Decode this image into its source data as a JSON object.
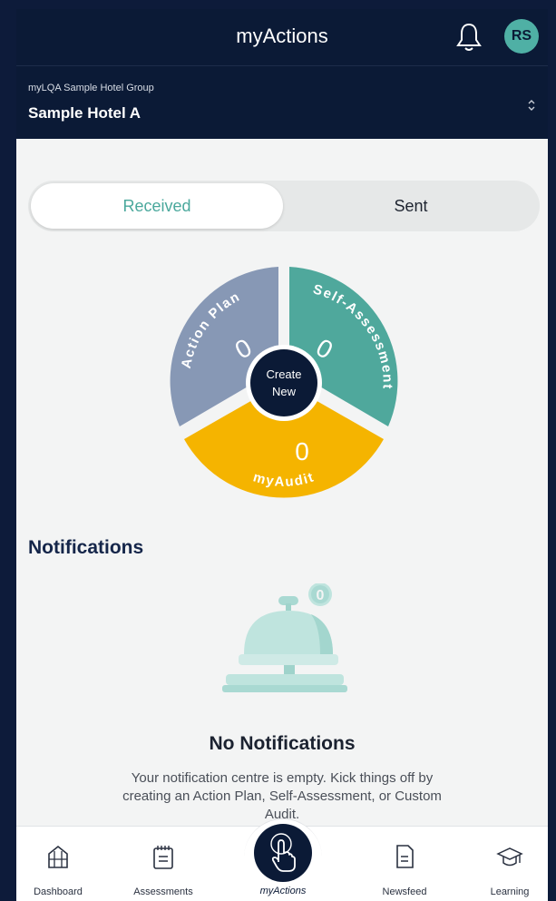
{
  "header": {
    "title": "myActions",
    "avatar_initials": "RS"
  },
  "hotel_bar": {
    "group": "myLQA Sample Hotel Group",
    "hotel": "Sample Hotel A"
  },
  "tabs": {
    "received": "Received",
    "sent": "Sent"
  },
  "dial": {
    "action_plan": {
      "label": "Action Plan",
      "count": "0",
      "color": "#8798b5"
    },
    "self_assessment": {
      "label": "Self-Assessment",
      "count": "0",
      "color": "#4fa89c"
    },
    "my_audit": {
      "label": "myAudit",
      "count": "0",
      "color": "#f5b400"
    },
    "center": {
      "line1": "Create",
      "line2": "New"
    }
  },
  "notifications": {
    "heading": "Notifications",
    "badge_count": "0",
    "empty_title": "No Notifications",
    "empty_text": "Your notification centre is empty. Kick things off by creating an Action Plan, Self-Assessment, or Custom Audit."
  },
  "bottom_nav": {
    "dashboard": "Dashboard",
    "assessments": "Assessments",
    "myactions": "myActions",
    "newsfeed": "Newsfeed",
    "learning": "Learning"
  },
  "icons": [
    "bell-icon",
    "sort-icon",
    "dashboard-icon",
    "assessments-icon",
    "touch-icon",
    "newsfeed-icon",
    "learning-icon"
  ]
}
